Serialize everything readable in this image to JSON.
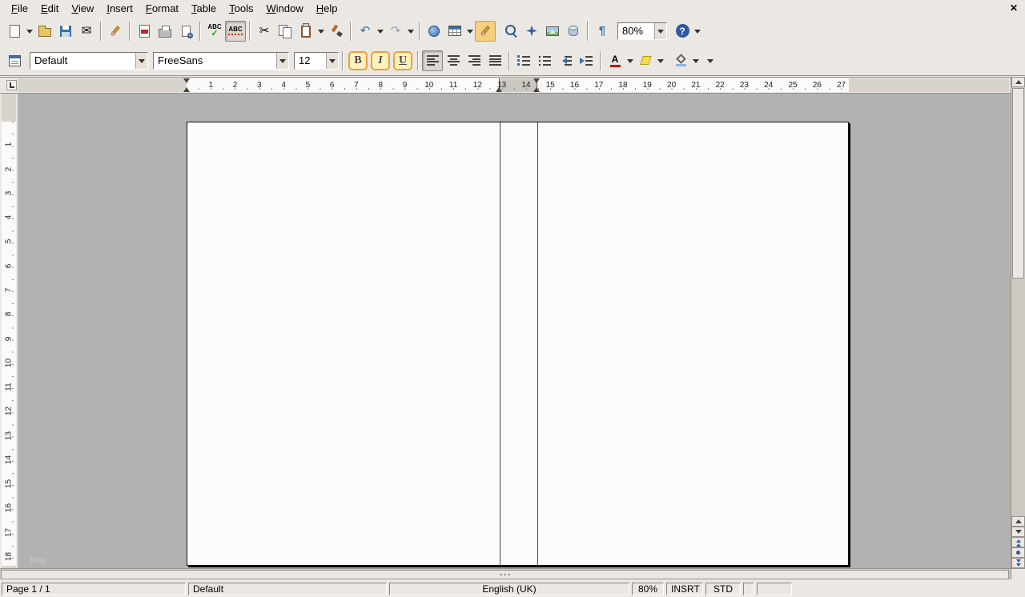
{
  "menubar": {
    "items": [
      "File",
      "Edit",
      "View",
      "Insert",
      "Format",
      "Table",
      "Tools",
      "Window",
      "Help"
    ],
    "close": "✕"
  },
  "icons": {
    "email_glyph": "✉",
    "cut_glyph": "✂",
    "undo_glyph": "↶",
    "redo_glyph": "↷",
    "spellcheck_text": "ABC",
    "spellcheck_mark": "✓",
    "autospell_text": "ABC",
    "pilcrow": "¶",
    "help_text": "?"
  },
  "standard_toolbar": {
    "zoom_value": "80%"
  },
  "formatting_toolbar": {
    "paragraph_style": "Default",
    "font_name": "FreeSans",
    "font_size": "12",
    "bold": "B",
    "italic": "I",
    "underline": "U",
    "fontcolor_letter": "A"
  },
  "hruler": {
    "numbers": [
      1,
      2,
      3,
      4,
      5,
      6,
      7,
      8,
      9,
      10,
      11,
      12,
      13,
      14,
      15,
      16,
      17,
      18,
      19,
      20,
      21,
      22,
      23,
      24,
      25,
      26,
      27
    ]
  },
  "vruler": {
    "numbers": [
      1,
      2,
      3,
      4,
      5,
      6,
      7,
      8,
      9,
      10,
      11,
      12,
      13,
      14,
      15,
      16,
      17,
      18
    ]
  },
  "document": {
    "frame_label": "blog"
  },
  "statusbar": {
    "page": "Page 1 / 1",
    "page_style": "Default",
    "language": "English (UK)",
    "zoom": "80%",
    "insert_mode": "INSRT",
    "selection_mode": "STD"
  }
}
